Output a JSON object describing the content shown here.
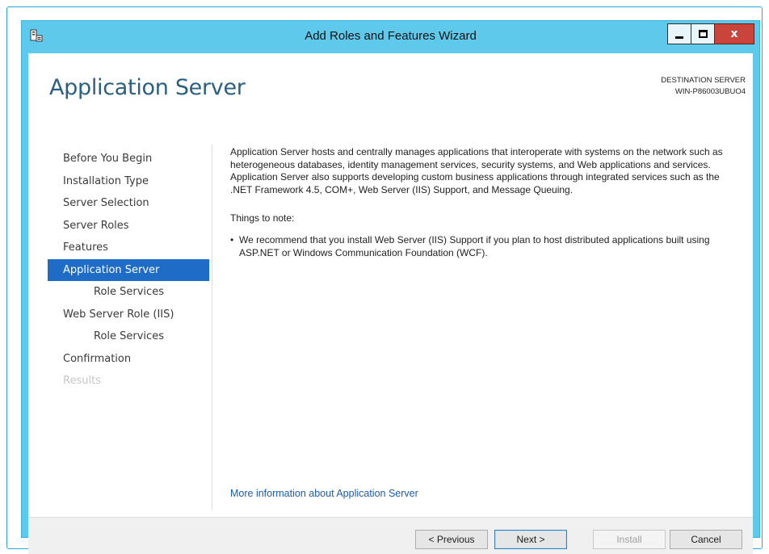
{
  "window": {
    "title": "Add Roles and Features Wizard",
    "icon": "server-manager-icon",
    "controls": {
      "minimize": "minimize-icon",
      "maximize": "maximize-icon",
      "close_glyph": "x"
    }
  },
  "header": {
    "page_title": "Application Server",
    "destination_label": "DESTINATION SERVER",
    "destination_value": "WIN-P86003UBUO4"
  },
  "nav": {
    "items": [
      {
        "label": "Before You Begin",
        "state": "normal"
      },
      {
        "label": "Installation Type",
        "state": "normal"
      },
      {
        "label": "Server Selection",
        "state": "normal"
      },
      {
        "label": "Server Roles",
        "state": "normal"
      },
      {
        "label": "Features",
        "state": "normal"
      },
      {
        "label": "Application Server",
        "state": "active"
      },
      {
        "label": "Role Services",
        "state": "sub"
      },
      {
        "label": "Web Server Role (IIS)",
        "state": "normal"
      },
      {
        "label": "Role Services",
        "state": "sub"
      },
      {
        "label": "Confirmation",
        "state": "normal"
      },
      {
        "label": "Results",
        "state": "disabled"
      }
    ]
  },
  "content": {
    "description": "Application Server hosts and centrally manages applications that interoperate with systems on the network such as heterogeneous databases, identity management services, security systems, and Web applications and services. Application Server also supports developing custom business applications through integrated services such as the .NET Framework 4.5, COM+, Web Server (IIS) Support, and Message Queuing.",
    "note_title": "Things to note:",
    "bullet_char": "•",
    "notes": [
      "We recommend that you install Web Server (IIS) Support if you plan to host distributed applications built using ASP.NET or Windows Communication Foundation (WCF)."
    ],
    "more_info_link": "More information about Application Server"
  },
  "footer": {
    "previous_label": "< Previous",
    "next_label": "Next >",
    "install_label": "Install",
    "cancel_label": "Cancel"
  },
  "colors": {
    "title_bar": "#5fc9ec",
    "accent_nav": "#1f6cc6",
    "page_title": "#2b6082",
    "link": "#1c5cad",
    "close_button": "#c9453c"
  }
}
